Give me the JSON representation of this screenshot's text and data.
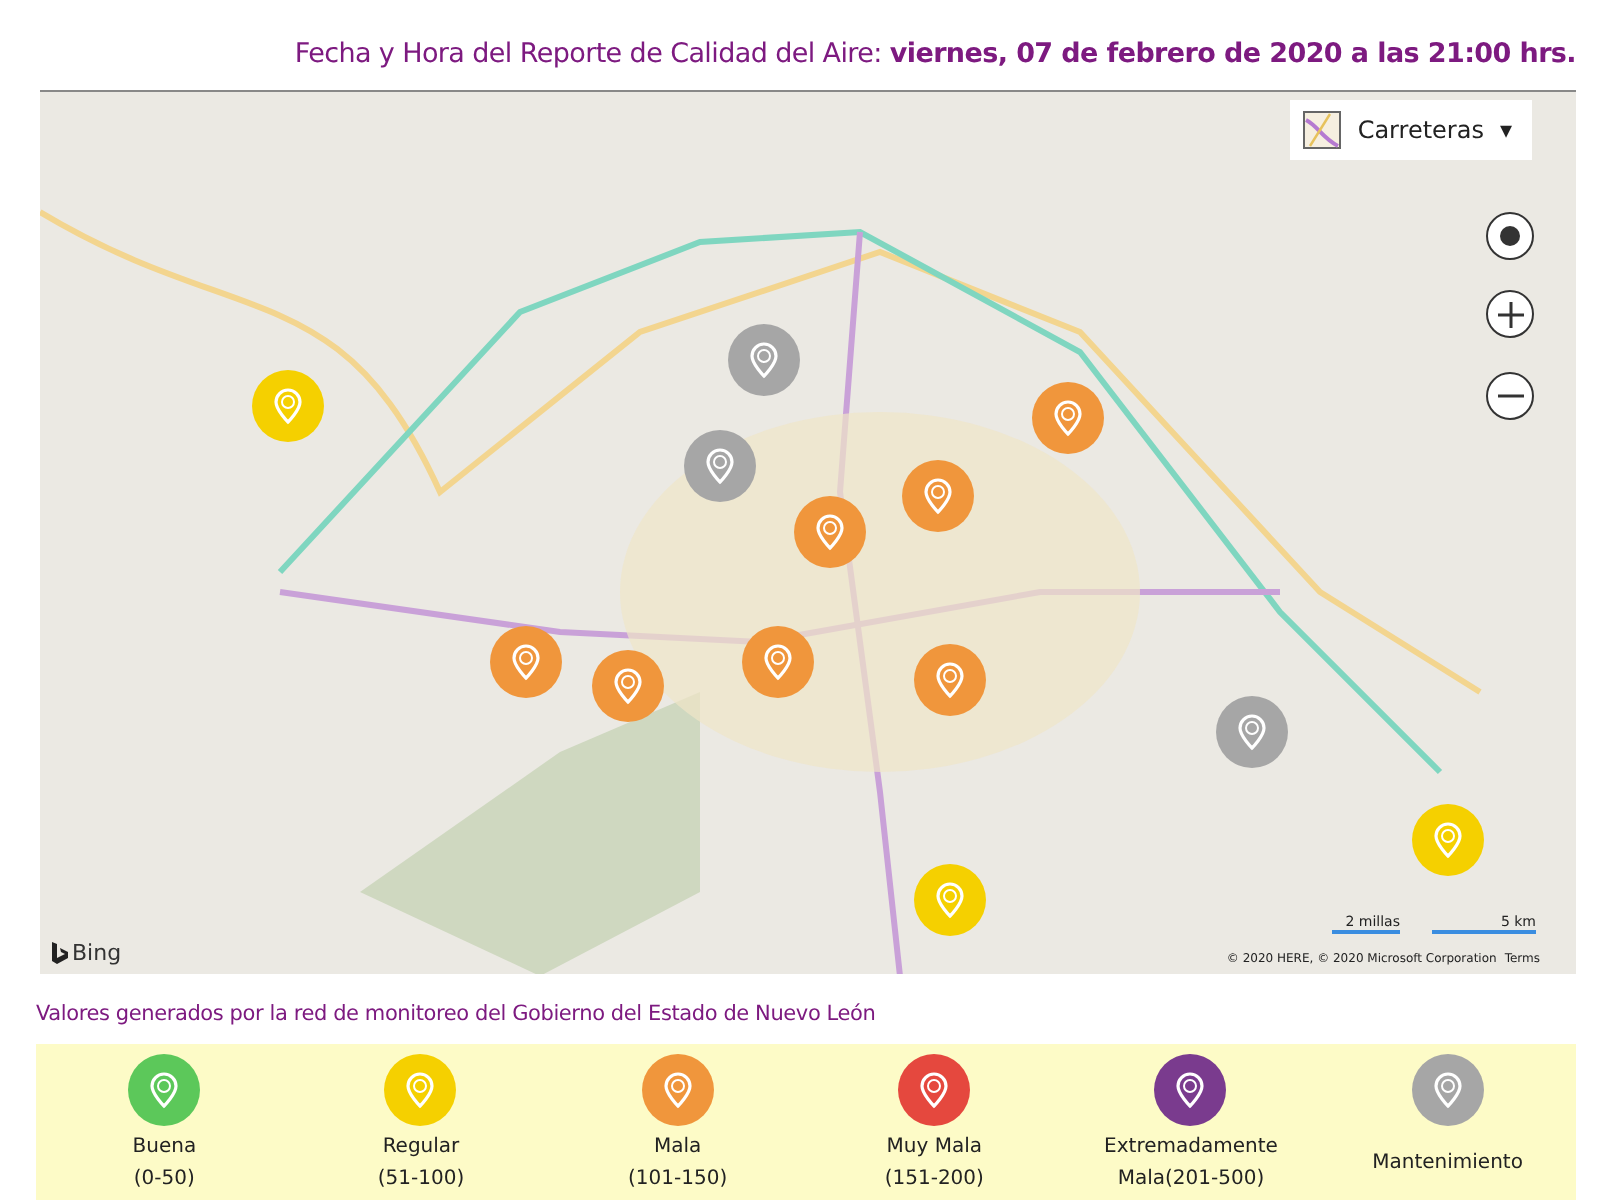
{
  "header": {
    "text": "Fecha y Hora del Reporte de Calidad del Aire: **viernes, 07 de febrero de 2020 a las 21:00 hrs.**"
  },
  "map": {
    "layer_button": "Carreteras",
    "dropdown_caret": "▾",
    "logo": "Bing",
    "scale": [
      "2 millas",
      "5 km"
    ],
    "attribution": "© 2020 HERE, © 2020 Microsoft Corporation",
    "terms_link": "Terms",
    "stations": [
      {
        "color": "#f5d000"
      },
      {
        "color": "#a6a6a6"
      },
      {
        "color": "#a6a6a6"
      },
      {
        "color": "#f0963c"
      },
      {
        "color": "#f0963c"
      },
      {
        "color": "#f0963c"
      },
      {
        "color": "#f0963c"
      },
      {
        "color": "#f0963c"
      },
      {
        "color": "#f0963c"
      },
      {
        "color": "#f0963c"
      },
      {
        "color": "#a6a6a6"
      },
      {
        "color": "#f5d000"
      },
      {
        "color": "#f5d000"
      }
    ]
  },
  "source_note": "Valores generados por la red de monitoreo del Gobierno del Estado de Nuevo León",
  "legend": [
    {
      "label": "Buena",
      "range": "(0-50)",
      "color": "#5cc85a"
    },
    {
      "label": "Regular",
      "range": "(51-100)",
      "color": "#f5d000"
    },
    {
      "label": "Mala",
      "range": "(101-150)",
      "color": "#f0963c"
    },
    {
      "label": "Muy Mala",
      "range": "(151-200)",
      "color": "#e5483e"
    },
    {
      "label": "Extremadamente",
      "range": "Mala(201-500)",
      "color": "#7a3b8e"
    },
    {
      "label": "Mantenimiento",
      "color": "#a6a6a6"
    }
  ]
}
